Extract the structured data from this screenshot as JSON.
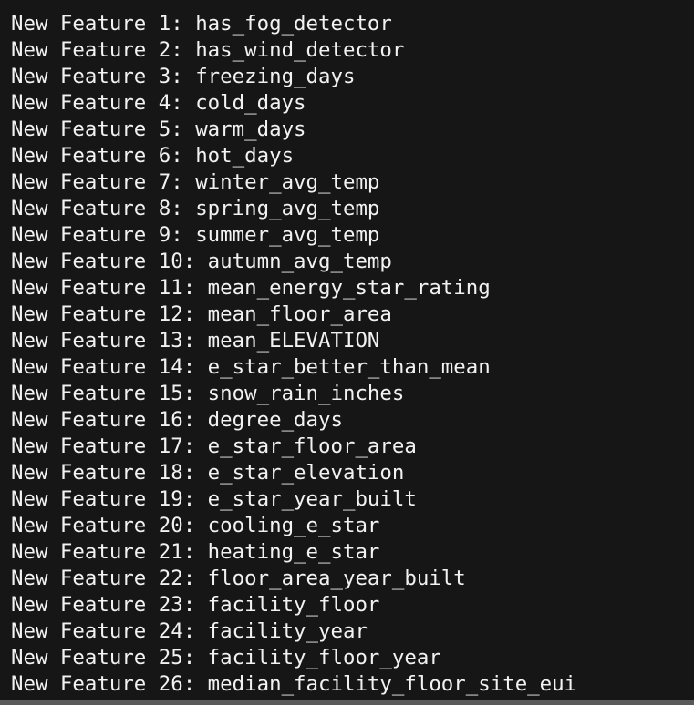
{
  "terminal": {
    "colors": {
      "background": "#161616",
      "text": "#f2f2f2",
      "scrollbar": "#5a5a5a"
    },
    "lines": [
      "New Feature 1: has_fog_detector",
      "New Feature 2: has_wind_detector",
      "New Feature 3: freezing_days",
      "New Feature 4: cold_days",
      "New Feature 5: warm_days",
      "New Feature 6: hot_days",
      "New Feature 7: winter_avg_temp",
      "New Feature 8: spring_avg_temp",
      "New Feature 9: summer_avg_temp",
      "New Feature 10: autumn_avg_temp",
      "New Feature 11: mean_energy_star_rating",
      "New Feature 12: mean_floor_area",
      "New Feature 13: mean_ELEVATION",
      "New Feature 14: e_star_better_than_mean",
      "New Feature 15: snow_rain_inches",
      "New Feature 16: degree_days",
      "New Feature 17: e_star_floor_area",
      "New Feature 18: e_star_elevation",
      "New Feature 19: e_star_year_built",
      "New Feature 20: cooling_e_star",
      "New Feature 21: heating_e_star",
      "New Feature 22: floor_area_year_built",
      "New Feature 23: facility_floor",
      "New Feature 24: facility_year",
      "New Feature 25: facility_floor_year",
      "New Feature 26: median_facility_floor_site_eui"
    ]
  }
}
